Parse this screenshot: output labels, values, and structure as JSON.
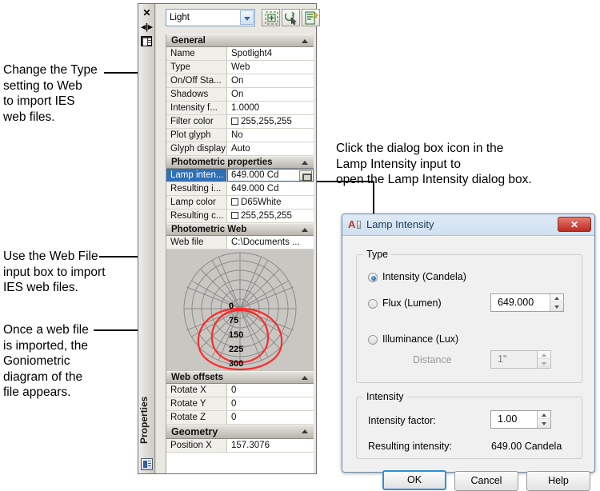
{
  "annotations": [
    {
      "id": "a1",
      "text": "Change the Type\nsetting to Web\nto import IES\nweb files."
    },
    {
      "id": "a2",
      "text": "Use the Web File\ninput box to import\nIES web files."
    },
    {
      "id": "a3",
      "text": "Once a web file\nis imported, the\nGoniometric\ndiagram of the\nfile appears."
    },
    {
      "id": "a4",
      "text": "Click the dialog box icon in the\nLamp Intensity input to\nopen the Lamp Intensity dialog box."
    }
  ],
  "palette": {
    "vertical_label": "Properties",
    "titlebar_icons": [
      "close-icon",
      "auto-hide-icon",
      "panel-menu-icon"
    ],
    "bottom_icon": "properties-panel-icon",
    "object_select": {
      "value": "Light",
      "arrow": "chevron-down-icon"
    },
    "tools": [
      {
        "name": "quick-select-button",
        "icon": "quick-select-icon"
      },
      {
        "name": "select-objects-button",
        "icon": "select-objects-icon"
      },
      {
        "name": "quick-properties-button",
        "icon": "quick-properties-icon"
      }
    ],
    "sections": [
      {
        "title": "General",
        "collapse_icon": "chevron-up-icon",
        "rows": [
          {
            "key": "Name",
            "value": "Spotlight4"
          },
          {
            "key": "Type",
            "value": "Web"
          },
          {
            "key": "On/Off Sta...",
            "value": "On"
          },
          {
            "key": "Shadows",
            "value": "On"
          },
          {
            "key": "Intensity f...",
            "value": "1.0000"
          },
          {
            "key": "Filter color",
            "value": "255,255,255",
            "swatch": "#ffffff"
          },
          {
            "key": "Plot glyph",
            "value": "No"
          },
          {
            "key": "Glyph display",
            "value": "Auto"
          }
        ]
      },
      {
        "title": "Photometric properties",
        "collapse_icon": "chevron-up-icon",
        "rows": [
          {
            "key": "Lamp inten...",
            "value": "649.000 Cd",
            "selected": true,
            "dialog_button": "lamp-intensity-dialog-button"
          },
          {
            "key": "Resulting i...",
            "value": "649.000 Cd"
          },
          {
            "key": "Lamp color",
            "value": "D65White",
            "swatch": "#ffffff"
          },
          {
            "key": "Resulting c...",
            "value": "255,255,255",
            "swatch": "#ffffff"
          }
        ]
      },
      {
        "title": "Photometric Web",
        "collapse_icon": "chevron-up-icon",
        "rows": [
          {
            "key": "Web file",
            "value": "C:\\Documents ..."
          }
        ]
      },
      {
        "title": "Web offsets",
        "collapse_icon": "chevron-up-icon",
        "rows": [
          {
            "key": "Rotate X",
            "value": "0"
          },
          {
            "key": "Rotate Y",
            "value": "0"
          },
          {
            "key": "Rotate Z",
            "value": "0"
          }
        ]
      },
      {
        "title": "Geometry",
        "collapse_icon": "chevron-up-icon",
        "rows": [
          {
            "key": "Position X",
            "value": "157.3076"
          }
        ]
      }
    ],
    "goniometric": {
      "name": "goniometric-diagram",
      "axis_labels": [
        "0",
        "75",
        "150",
        "225",
        "300"
      ],
      "grid_color": "#8b8b8b",
      "curve_color": "#fd2b2b",
      "background": "#c9c7c2"
    }
  },
  "dialog": {
    "title": "Lamp Intensity",
    "app_icon": "autocad-icon",
    "close_label": "✕",
    "type_group": {
      "legend": "Type",
      "options": [
        {
          "label": "Intensity (Candela)",
          "selected": true
        },
        {
          "label": "Flux (Lumen)",
          "selected": false
        },
        {
          "label": "Illuminance (Lux)",
          "selected": false
        }
      ],
      "flux_value": "649.000",
      "distance_label": "Distance",
      "distance_value": "1\"",
      "distance_disabled": true
    },
    "intensity_group": {
      "legend": "Intensity",
      "factor_label": "Intensity factor:",
      "factor_value": "1.00",
      "resulting_label": "Resulting intensity:",
      "resulting_value": "649.00 Candela"
    },
    "buttons": [
      {
        "label": "OK",
        "default": true
      },
      {
        "label": "Cancel",
        "default": false
      },
      {
        "label": "Help",
        "default": false
      }
    ]
  }
}
